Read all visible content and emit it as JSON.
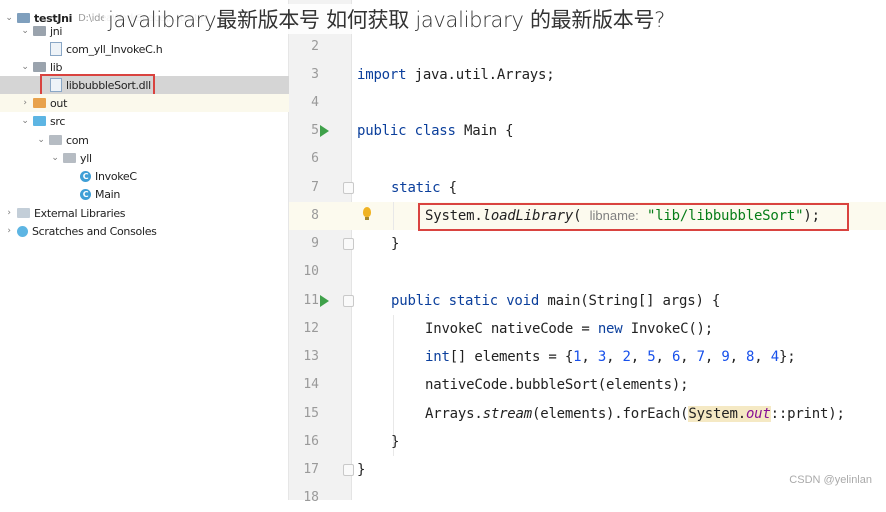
{
  "overlay_title": "javalibrary最新版本号 如何获取 javalibrary 的最新版本号?",
  "watermark": "CSDN @yelinlan",
  "project_tree": {
    "root": {
      "label": "testJni",
      "path_hint": "D:\\ideaWorkSpace\\...\\testJni"
    },
    "items": [
      {
        "label": "jni",
        "type": "folder",
        "expanded": true
      },
      {
        "label": "com_yll_InvokeC.h",
        "type": "file"
      },
      {
        "label": "lib",
        "type": "folder",
        "expanded": true
      },
      {
        "label": "libbubbleSort.dll",
        "type": "file",
        "selected": true
      },
      {
        "label": "out",
        "type": "folder",
        "expanded": false
      },
      {
        "label": "src",
        "type": "folder",
        "expanded": true
      },
      {
        "label": "com",
        "type": "package",
        "expanded": true
      },
      {
        "label": "yll",
        "type": "package",
        "expanded": true
      },
      {
        "label": "InvokeC",
        "type": "class",
        "icon_letter": "C"
      },
      {
        "label": "Main",
        "type": "class",
        "icon_letter": "C"
      },
      {
        "label": "External Libraries",
        "type": "libraries",
        "expanded": false
      },
      {
        "label": "Scratches and Consoles",
        "type": "scratches",
        "expanded": false
      }
    ]
  },
  "editor": {
    "line_numbers": [
      "2",
      "3",
      "4",
      "5",
      "6",
      "7",
      "8",
      "9",
      "10",
      "11",
      "12",
      "13",
      "14",
      "15",
      "16",
      "17",
      "18"
    ],
    "code": {
      "l3_import": "import",
      "l3_rest": " java.util.Arrays;",
      "l5_public": "public",
      "l5_class": "class",
      "l5_rest": " Main {",
      "l7_static": "static",
      "l7_rest": " {",
      "l8_system": "System.",
      "l8_method": "loadLibrary",
      "l8_open": "( ",
      "l8_hint": "libname:",
      "l8_string": "\"lib/libbubbleSort\"",
      "l8_close": ");",
      "l9_close": "}",
      "l11_kw": "public static void",
      "l11_rest": " main(String[] args) {",
      "l12_pre": "InvokeC nativeCode = ",
      "l12_new": "new",
      "l12_rest": " InvokeC();",
      "l13_int": "int",
      "l13_mid": "[] elements = {",
      "l13_numbers": [
        "1",
        "3",
        "2",
        "5",
        "6",
        "7",
        "9",
        "8",
        "4"
      ],
      "l13_end": "};",
      "l14": "nativeCode.bubbleSort(elements);",
      "l15_pre": "Arrays.",
      "l15_stream": "stream",
      "l15_mid": "(elements).forEach(",
      "l15_system": "System.",
      "l15_out": "out",
      "l15_end": "::print);",
      "l16_close": "}",
      "l17_close": "}"
    }
  }
}
